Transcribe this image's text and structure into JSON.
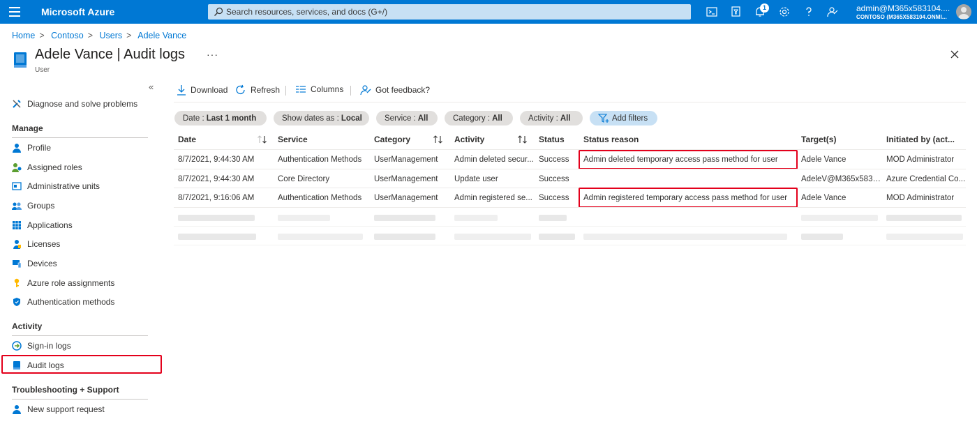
{
  "topbar": {
    "brand": "Microsoft Azure",
    "search_placeholder": "Search resources, services, and docs (G+/)",
    "notification_count": "1",
    "account_user": "admin@M365x583104....",
    "account_tenant": "CONTOSO (M365X583104.ONMI...",
    "icons": [
      "cloud-shell-icon",
      "directory-filter-icon",
      "notifications-icon",
      "settings-icon",
      "help-icon",
      "feedback-icon"
    ]
  },
  "breadcrumb": [
    "Home",
    "Contoso",
    "Users",
    "Adele Vance"
  ],
  "page": {
    "title": "Adele Vance | Audit logs",
    "subtitle": "User",
    "more": "···"
  },
  "sidebar": {
    "top_item": "Diagnose and solve problems",
    "sections": {
      "manage": "Manage",
      "activity": "Activity",
      "troubleshooting": "Troubleshooting + Support"
    },
    "manage_items": [
      "Profile",
      "Assigned roles",
      "Administrative units",
      "Groups",
      "Applications",
      "Licenses",
      "Devices",
      "Azure role assignments",
      "Authentication methods"
    ],
    "activity_items": [
      "Sign-in logs",
      "Audit logs"
    ],
    "support_items": [
      "New support request"
    ],
    "selected": "Audit logs"
  },
  "toolbar": {
    "download": "Download",
    "refresh": "Refresh",
    "columns": "Columns",
    "feedback": "Got feedback?"
  },
  "filters": [
    {
      "label": "Date :",
      "value": "Last 1 month"
    },
    {
      "label": "Show dates as :",
      "value": "Local"
    },
    {
      "label": "Service :",
      "value": "All"
    },
    {
      "label": "Category :",
      "value": "All"
    },
    {
      "label": "Activity :",
      "value": "All"
    }
  ],
  "add_filters": "Add filters",
  "table": {
    "columns": [
      "Date",
      "Service",
      "Category",
      "Activity",
      "Status",
      "Status reason",
      "Target(s)",
      "Initiated by (act..."
    ],
    "rows": [
      [
        "8/7/2021, 9:44:30 AM",
        "Authentication Methods",
        "UserManagement",
        "Admin deleted secur...",
        "Success",
        "Admin deleted temporary access pass method for user",
        "Adele Vance",
        "MOD Administrator"
      ],
      [
        "8/7/2021, 9:44:30 AM",
        "Core Directory",
        "UserManagement",
        "Update user",
        "Success",
        "",
        "AdeleV@M365x5831...",
        "Azure Credential Co..."
      ],
      [
        "8/7/2021, 9:16:06 AM",
        "Authentication Methods",
        "UserManagement",
        "Admin registered se...",
        "Success",
        "Admin registered temporary access pass method for user",
        "Adele Vance",
        "MOD Administrator"
      ]
    ]
  },
  "colors": {
    "accent": "#0078d4",
    "highlight": "#e3001b"
  }
}
